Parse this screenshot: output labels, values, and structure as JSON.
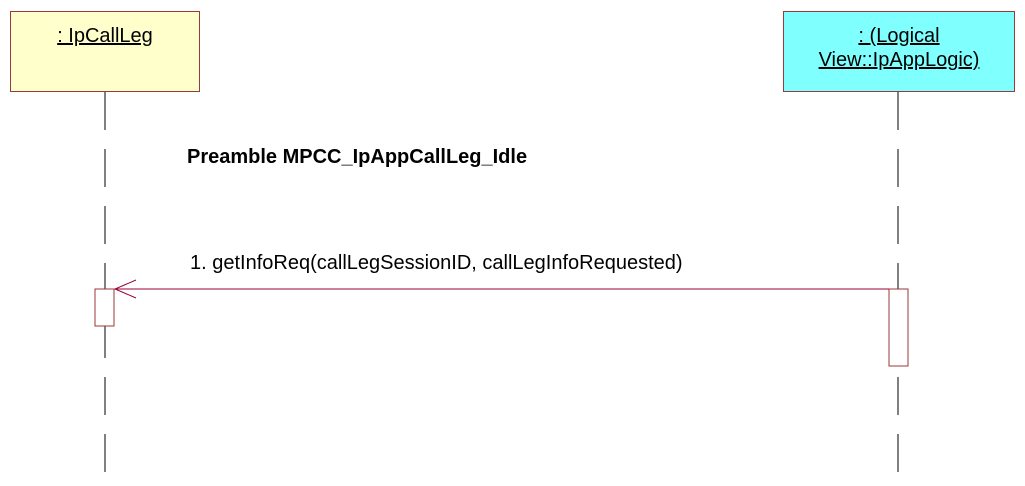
{
  "lifelines": [
    {
      "label_lines": [
        " : IpCallLeg"
      ],
      "fill": "#ffffcc"
    },
    {
      "label_lines": [
        " : (Logical ",
        "View::IpAppLogic)"
      ],
      "fill": "#80ffff"
    }
  ],
  "note": "Preamble MPCC_IpAppCallLeg_Idle",
  "messages": [
    {
      "label": "1. getInfoReq(callLegSessionID, callLegInfoRequested)"
    }
  ],
  "colors": {
    "border": "#9a3a3a",
    "lifeline": "#000000",
    "arrow": "#990033"
  }
}
